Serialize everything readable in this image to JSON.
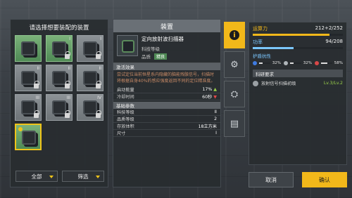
{
  "left": {
    "title": "请选择想要装配的装置",
    "items": [
      {
        "tier": "",
        "green": true,
        "lock": false,
        "pin": false
      },
      {
        "tier": "I",
        "green": true,
        "lock": true,
        "pin": false
      },
      {
        "tier": "I",
        "green": false,
        "lock": true,
        "pin": false
      },
      {
        "tier": "II",
        "green": false,
        "lock": true,
        "pin": false
      },
      {
        "tier": "II",
        "green": false,
        "lock": true,
        "pin": false
      },
      {
        "tier": "II",
        "green": false,
        "lock": true,
        "pin": false
      },
      {
        "tier": "III",
        "green": false,
        "lock": true,
        "pin": false
      },
      {
        "tier": "III",
        "green": false,
        "lock": true,
        "pin": false
      },
      {
        "tier": "IV",
        "green": false,
        "lock": true,
        "pin": false
      },
      {
        "tier": "",
        "green": true,
        "lock": false,
        "pin": true
      }
    ],
    "filter_all_label": "全部",
    "filter_label": "筛选"
  },
  "mid": {
    "header": "装置",
    "item_name": "定向放射波扫描器",
    "tech_level_label": "科技等级",
    "quality_label": "品质",
    "quality_value": "精良",
    "effect_head": "激活效果",
    "desc": "尝试定位当前恒星系内隐藏的脑能残骸信号，扫描时将根据自身40%的感应强度返回不同的定位精准度。",
    "stats": [
      {
        "label": "启动能量",
        "value": "17%",
        "arrow": "up"
      },
      {
        "label": "冷却时间",
        "value": "60秒",
        "arrow": "down"
      }
    ],
    "base_head": "基础参数",
    "base": [
      {
        "label": "科技等级",
        "value": "II"
      },
      {
        "label": "品质等级",
        "value": "2"
      },
      {
        "label": "存放体积",
        "value": "18立方米"
      },
      {
        "label": "尺寸",
        "value": "I"
      }
    ]
  },
  "tabs": [
    {
      "name": "info-tab",
      "glyph": "i"
    },
    {
      "name": "module-tab",
      "glyph": "⚙"
    },
    {
      "name": "config-tab",
      "glyph": "⛭"
    },
    {
      "name": "cargo-tab",
      "glyph": "▤"
    }
  ],
  "right": {
    "power_label": "运算力",
    "power_value": "212+2/252",
    "power_frac": 0.85,
    "eff_label": "功率",
    "eff_value": "94/208",
    "eff_frac": 0.45,
    "armor_label": "护盾抗性",
    "armor": [
      {
        "value": "32%",
        "color": "#3f7be0",
        "frac": 0.32
      },
      {
        "value": "32%",
        "color": "#b0b6ba",
        "frac": 0.32
      },
      {
        "value": "58%",
        "color": "#d84848",
        "frac": 0.58
      }
    ],
    "research_head": "科研要求",
    "research_item": "放射信号扫描初级",
    "research_level": "Lv.3/Lv.2"
  },
  "buttons": {
    "cancel": "取消",
    "confirm": "确认"
  },
  "colors": {
    "accent": "#f2b81a",
    "green": "#4f8a55",
    "power": "#f2b81a",
    "eff": "#7bc7ff"
  }
}
